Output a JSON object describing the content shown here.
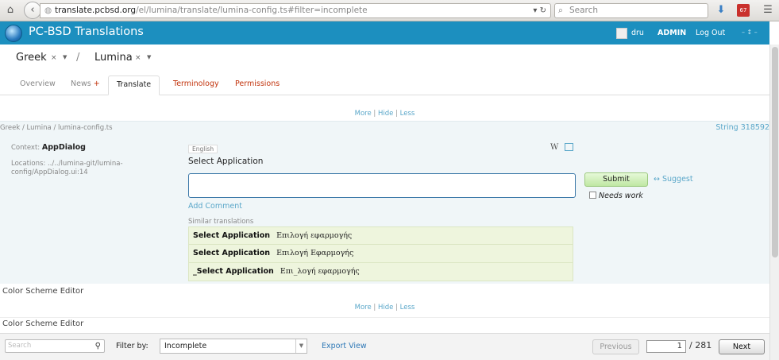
{
  "browser": {
    "url_domain": "translate.pcbsd.org",
    "url_path": "/el/lumina/translate/lumina-config.ts#filter=incomplete",
    "search_placeholder": "Search",
    "badge_count": "67"
  },
  "header": {
    "title": "PC-BSD Translations",
    "user": "dru",
    "admin": "ADMIN",
    "logout": "Log Out",
    "extras": "– ↕ –"
  },
  "breadcrumb": {
    "language": "Greek",
    "separator": "/",
    "project": "Lumina",
    "close": "×",
    "dropdown": "▼"
  },
  "tabs": [
    {
      "label": "Overview"
    },
    {
      "label": "News"
    },
    {
      "label": "Translate"
    },
    {
      "label": "Terminology"
    },
    {
      "label": "Permissions"
    }
  ],
  "news_plus": "+",
  "nav": {
    "more": "More",
    "hide": "Hide",
    "less": "Less",
    "sep": "|"
  },
  "unit": {
    "path": "Greek / Lumina / lumina-config.ts",
    "string_no": "String 318592",
    "context_label": "Context:",
    "context_value": "AppDialog",
    "locations_label": "Locations:",
    "locations_value": "../../lumina-git/lumina-config/AppDialog.ui:14",
    "source_lang": "English",
    "source_text": "Select Application",
    "wiki_icon": "W",
    "submit": "Submit",
    "suggest": "↔ Suggest",
    "needs_work": "Needs work",
    "add_comment": "Add Comment",
    "similar_label": "Similar translations",
    "similar": [
      {
        "source": "Select Application",
        "target": "Επιλογή εφαρμογής"
      },
      {
        "source": "Select Application",
        "target": "Επιλογή Εφαρμογής"
      },
      {
        "source": "_Select Application",
        "target": "Επι_λογή εφαρμογής"
      }
    ]
  },
  "next_units": [
    {
      "text": "Color Scheme Editor"
    },
    {
      "text": "Color Scheme Editor"
    }
  ],
  "footer": {
    "search_placeholder": "Search",
    "filter_label": "Filter by:",
    "filter_value": "Incomplete",
    "export": "Export View",
    "previous": "Previous",
    "page": "1",
    "total": "/ 281",
    "next": "Next"
  }
}
